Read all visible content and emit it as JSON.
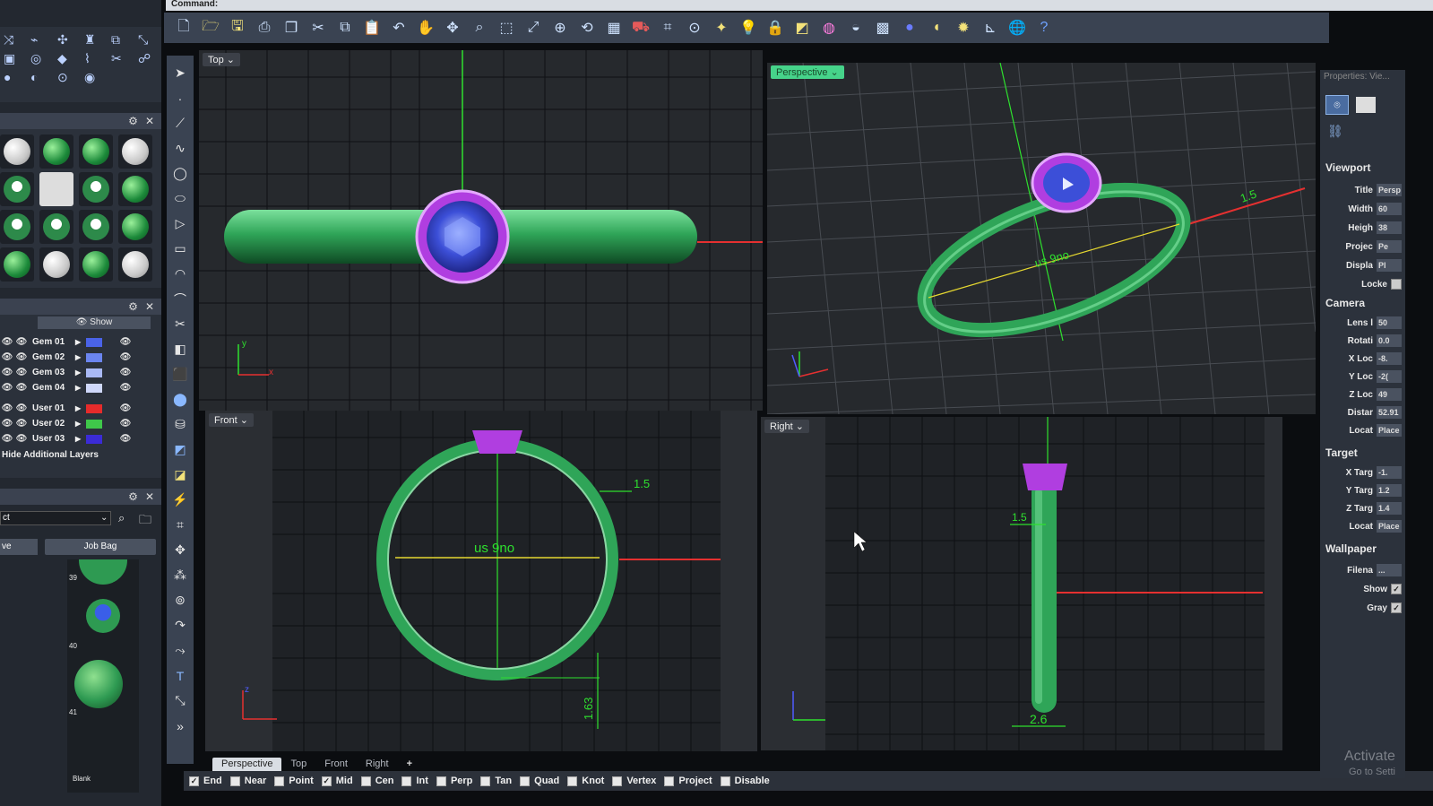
{
  "command_bar": {
    "label": "Command:"
  },
  "viewports": {
    "top": {
      "label": "Top"
    },
    "perspective": {
      "label": "Perspective"
    },
    "front": {
      "label": "Front",
      "dim_width": "1.5",
      "dim_size": "us 9no",
      "dim_height": "1.63"
    },
    "right": {
      "label": "Right",
      "dim_width": "1.5",
      "dim_bottom": "2.6"
    },
    "perspective_dims": {
      "dim_size": "us 9no",
      "dim_width": "1.5"
    }
  },
  "tabs": [
    "Perspective",
    "Top",
    "Front",
    "Right"
  ],
  "osnap": [
    {
      "label": "End",
      "checked": true
    },
    {
      "label": "Near",
      "checked": false
    },
    {
      "label": "Point",
      "checked": false
    },
    {
      "label": "Mid",
      "checked": true
    },
    {
      "label": "Cen",
      "checked": false
    },
    {
      "label": "Int",
      "checked": false
    },
    {
      "label": "Perp",
      "checked": false
    },
    {
      "label": "Tan",
      "checked": false
    },
    {
      "label": "Quad",
      "checked": false
    },
    {
      "label": "Knot",
      "checked": false
    },
    {
      "label": "Vertex",
      "checked": false
    },
    {
      "label": "Project",
      "checked": false
    },
    {
      "label": "Disable",
      "checked": false
    }
  ],
  "layers": {
    "show_label": "Show",
    "rows": [
      {
        "name": "Gem 01",
        "color": "#4a63e8"
      },
      {
        "name": "Gem 02",
        "color": "#6b85f0"
      },
      {
        "name": "Gem 03",
        "color": "#a9b9f5"
      },
      {
        "name": "Gem 04",
        "color": "#cfd8fa"
      },
      {
        "name": "User 01",
        "color": "#e62b2b"
      },
      {
        "name": "User 02",
        "color": "#3fc84a"
      },
      {
        "name": "User 03",
        "color": "#3b2bd6"
      }
    ],
    "hide_label": "Hide Additional Layers"
  },
  "library": {
    "search_value": "ct",
    "save_label": "ve",
    "jobbag_label": "Job Bag",
    "items": [
      {
        "num": "39"
      },
      {
        "num": "40"
      },
      {
        "num": "41"
      },
      {
        "num": "",
        "label": "Blank"
      }
    ]
  },
  "properties": {
    "header": "Properties: Vie...",
    "viewport_title": "Viewport",
    "viewport_rows": [
      {
        "label": "Title",
        "value": "Persp"
      },
      {
        "label": "Width",
        "value": "60"
      },
      {
        "label": "Heigh",
        "value": "38"
      },
      {
        "label": "Projec",
        "value": "Pe"
      },
      {
        "label": "Displa",
        "value": "Pl"
      },
      {
        "label": "Locke",
        "value": ""
      }
    ],
    "camera_title": "Camera",
    "camera_rows": [
      {
        "label": "Lens l",
        "value": "50"
      },
      {
        "label": "Rotati",
        "value": "0.0"
      },
      {
        "label": "X Loc",
        "value": "-8."
      },
      {
        "label": "Y Loc",
        "value": "-2("
      },
      {
        "label": "Z Loc",
        "value": "49"
      },
      {
        "label": "Distar",
        "value": "52.91"
      },
      {
        "label": "Locat",
        "value": "Place"
      }
    ],
    "target_title": "Target",
    "target_rows": [
      {
        "label": "X Targ",
        "value": "-1."
      },
      {
        "label": "Y Targ",
        "value": "1.2"
      },
      {
        "label": "Z Targ",
        "value": "1.4"
      },
      {
        "label": "Locat",
        "value": "Place"
      }
    ],
    "wallpaper_title": "Wallpaper",
    "wallpaper_rows": [
      {
        "label": "Filena",
        "value": "..."
      },
      {
        "label": "Show",
        "value": "✓"
      },
      {
        "label": "Gray",
        "value": "✓"
      }
    ]
  },
  "watermark": {
    "title": "Activate",
    "sub": "Go to Setti"
  },
  "colors": {
    "ring": "#2fa558",
    "gem": "#3c4fd8",
    "bezel": "#b03ee0",
    "axis_x": "#e53030",
    "axis_y": "#2ee02e"
  }
}
